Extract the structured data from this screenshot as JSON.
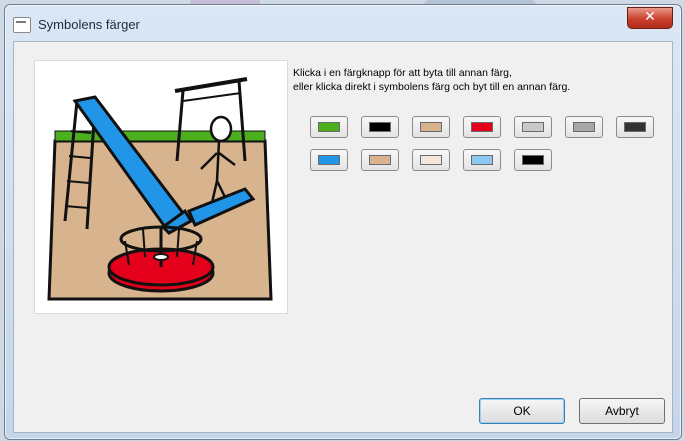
{
  "window": {
    "title": "Symbolens färger",
    "close_glyph": "✕"
  },
  "instructions": {
    "line1": "Klicka i en färgknapp för att byta till annan färg,",
    "line2": "eller klicka direkt i symbolens färg och byt till en annan färg."
  },
  "swatch_rows": [
    [
      "#4caf1e",
      "#000000",
      "#d8b48e",
      "#e4001b",
      "#c9c9c9",
      "#a8a8a8",
      "#333333"
    ],
    [
      "#2196e8",
      "#d8b48e",
      "#f5e6dc",
      "#8cc9f2",
      "#000000"
    ]
  ],
  "buttons": {
    "ok": "OK",
    "cancel": "Avbryt"
  }
}
